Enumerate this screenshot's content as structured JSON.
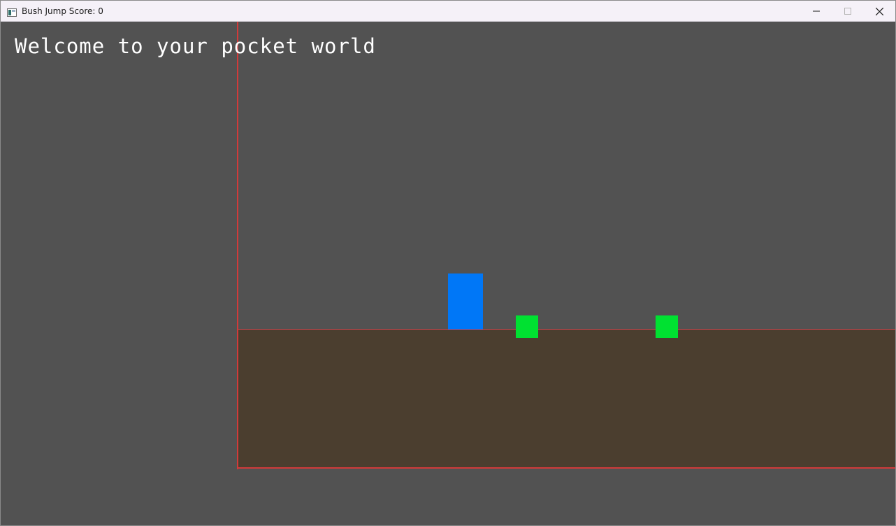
{
  "window": {
    "title": "Bush Jump Score: 0",
    "app_icon": "window-app-icon",
    "controls": {
      "minimize_icon": "minimize-icon",
      "maximize_icon": "maximize-icon",
      "close_icon": "close-icon"
    }
  },
  "game": {
    "welcome_message": "Welcome to your pocket world",
    "colors": {
      "background": "#525252",
      "ground": "#4b3e2f",
      "boundary": "#d13a3a",
      "player": "#0077f7",
      "bush": "#00e131",
      "text": "#ffffff"
    },
    "bush_count": 2
  }
}
